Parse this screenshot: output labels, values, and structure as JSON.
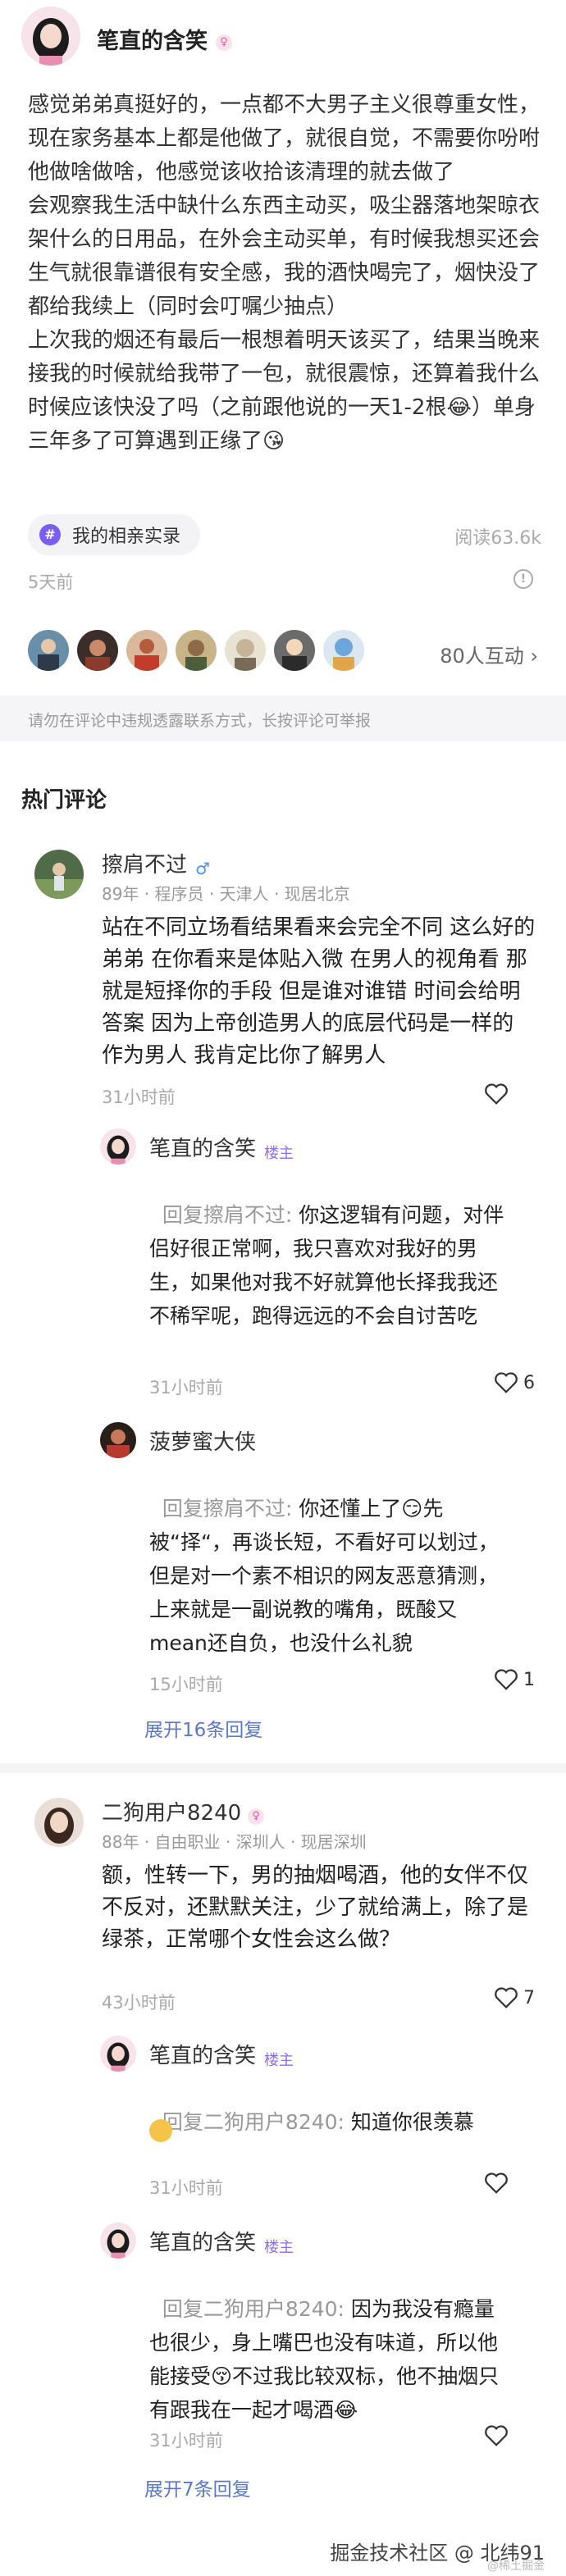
{
  "post": {
    "author": "笔直的含笑",
    "author_badge": "♀",
    "body": "感觉弟弟真挺好的，一点都不大男子主义很尊重女性，现在家务基本上都是他做了，就很自觉，不需要你吩咐他做啥做啥，他感觉该收拾该清理的就去做了\n会观察我生活中缺什么东西主动买，吸尘器落地架晾衣架什么的日用品，在外会主动买单，有时候我想买还会生气就很靠谱很有安全感，我的酒快喝完了，烟快没了都给我续上（同时会叮嘱少抽点）\n上次我的烟还有最后一根想着明天该买了，结果当晚来接我的时候就给我带了一包，就很震惊，还算着我什么时候应该快没了吗（之前跟他说的一天1-2根😂）单身三年多了可算遇到正缘了😘",
    "topic": "我的相亲实录",
    "views": "阅读63.6k",
    "time": "5天前",
    "interactions": "80人互动"
  },
  "notice": "请勿在评论中违规透露联系方式，长按评论可举报",
  "section_title": "热门评论",
  "comments": [
    {
      "name": "擦肩不过",
      "gender": "♂",
      "meta": "89年 · 程序员 · 天津人 · 现居北京",
      "body": "站在不同立场看结果看来会完全不同 这么好的弟弟 在你看来是体贴入微 在男人的视角看 那就是短择你的手段 但是谁对谁错 时间会给明答案 因为上帝创造男人的底层代码是一样的 作为男人 我肯定比你了解男人",
      "time": "31小时前",
      "likes": "",
      "replies": [
        {
          "name": "笔直的含笑",
          "tag": "楼主",
          "prefix": "回复擦肩不过: ",
          "text": "你这逻辑有问题，对伴侣好很正常啊，我只喜欢对我好的男生，如果他对我不好就算他长择我我还不稀罕呢，跑得远远的不会自讨苦吃",
          "time": "31小时前",
          "likes": "6"
        },
        {
          "name": "菠萝蜜大侠",
          "tag": "",
          "prefix": "回复擦肩不过: ",
          "text": "你还懂上了😏先被“择“，再谈长短，不看好可以划过，但是对一个素不相识的网友恶意猜测，上来就是一副说教的嘴角，既酸又mean还自负，也没什么礼貌",
          "time": "15小时前",
          "likes": "1"
        }
      ],
      "expand": "展开16条回复"
    },
    {
      "name": "二狗用户8240",
      "gender": "♀",
      "meta": "88年 · 自由职业 · 深圳人 · 现居深圳",
      "body": "额，性转一下，男的抽烟喝酒，他的女伴不仅不反对，还默默关注，少了就给满上，除了是绿茶，正常哪个女性会这么做？",
      "time": "43小时前",
      "likes": "7",
      "replies": [
        {
          "name": "笔直的含笑",
          "tag": "楼主",
          "prefix": "回复二狗用户8240: ",
          "text": "知道你很羡慕",
          "time": "31小时前",
          "likes": ""
        },
        {
          "name": "笔直的含笑",
          "tag": "楼主",
          "prefix": "回复二狗用户8240: ",
          "text": "因为我没有瘾量也很少，身上嘴巴也没有味道，所以他能接受😚不过我比较双标，他不抽烟只有跟我在一起才喝酒😂",
          "time": "31小时前",
          "likes": ""
        }
      ],
      "expand": "展开7条回复"
    }
  ],
  "watermark": "掘金技术社区 @ 北纬91",
  "watermark_small": "@稀土掘金"
}
